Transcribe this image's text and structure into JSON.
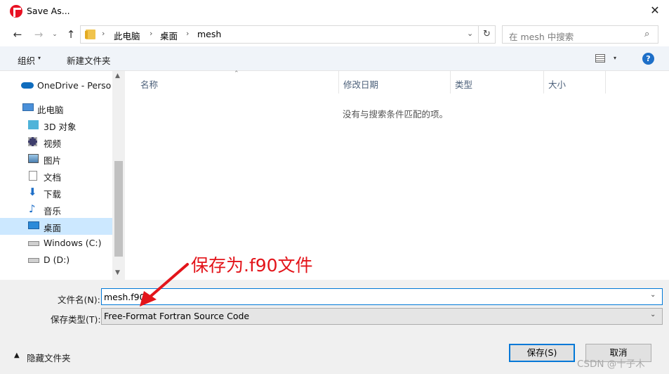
{
  "window": {
    "title": "Save As...",
    "close_glyph": "✕"
  },
  "nav": {
    "back": "←",
    "forward": "→",
    "recent": "⌄",
    "up": "↑"
  },
  "address": {
    "breadcrumb": [
      "此电脑",
      "桌面",
      "mesh"
    ],
    "separator": "›",
    "dropdown": "⌄",
    "refresh": "↻"
  },
  "search": {
    "placeholder": "在 mesh 中搜索",
    "icon": "⌕"
  },
  "toolbar": {
    "organize_label": "组织",
    "caret": "▾",
    "new_folder_label": "新建文件夹",
    "help_label": "?"
  },
  "sidebar": {
    "items": [
      {
        "label": "OneDrive - Perso",
        "icon": "onedrive-icon"
      },
      {
        "label": "此电脑",
        "icon": "this-pc-icon"
      },
      {
        "label": "3D 对象",
        "icon": "3d-objects-icon"
      },
      {
        "label": "视频",
        "icon": "videos-icon"
      },
      {
        "label": "图片",
        "icon": "pictures-icon"
      },
      {
        "label": "文档",
        "icon": "documents-icon"
      },
      {
        "label": "下载",
        "icon": "downloads-icon"
      },
      {
        "label": "音乐",
        "icon": "music-icon"
      },
      {
        "label": "桌面",
        "icon": "desktop-icon",
        "selected": true
      },
      {
        "label": "Windows (C:)",
        "icon": "drive-c-icon"
      },
      {
        "label": "D (D:)",
        "icon": "drive-d-icon"
      }
    ],
    "scroll_up": "▲",
    "scroll_down": "▼"
  },
  "filelist": {
    "columns": [
      "名称",
      "修改日期",
      "类型",
      "大小"
    ],
    "sort_indicator": "⌃",
    "empty_message": "没有与搜索条件匹配的项。"
  },
  "fields": {
    "filename_label": "文件名(N):",
    "filename_value": "mesh.f90",
    "filetype_label": "保存类型(T):",
    "filetype_value": "Free-Format Fortran Source Code",
    "dropdown_caret": "⌄"
  },
  "footer": {
    "hide_folders_label": "隐藏文件夹",
    "hide_caret": "▲",
    "save_label": "保存(S)",
    "cancel_label": "取消"
  },
  "annotation": {
    "text": "保存为.f90文件",
    "color": "#e3141a"
  },
  "watermark": "CSDN @十子木",
  "colors": {
    "accent": "#0078d7",
    "selected_bg": "#cce8ff",
    "toolbar_bg": "#f0f4f9"
  }
}
